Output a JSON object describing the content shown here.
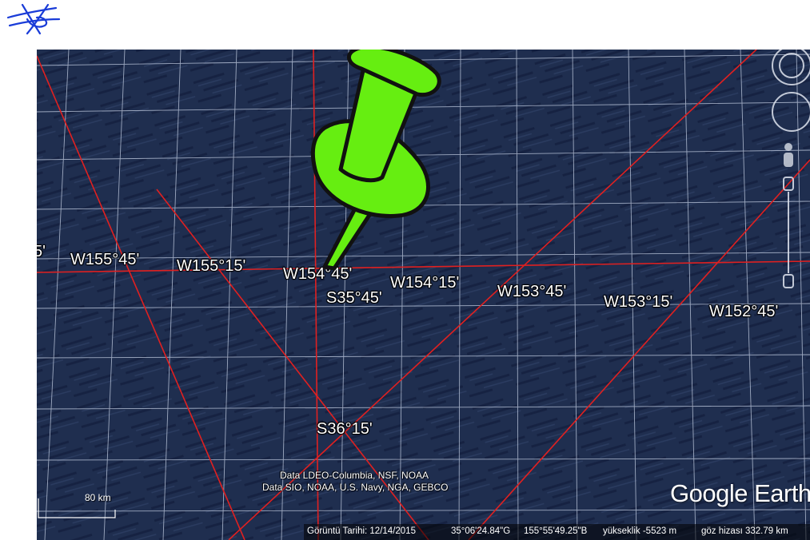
{
  "logo": {
    "icon": "signature-scribble-icon",
    "color": "#1a3cd8"
  },
  "map": {
    "grid_labels": {
      "longitudes": [
        "5'",
        "W155°45'",
        "W155°15'",
        "W154°45'",
        "W154°15'",
        "W153°45'",
        "W153°15'",
        "W152°45'"
      ],
      "latitudes": [
        "S35°45'",
        "S36°15'"
      ]
    },
    "placemark": {
      "icon": "pushpin-icon",
      "color": "#66ee11"
    },
    "ocean_color": "#1f2e4f",
    "line_color": "#e02020",
    "grid_color": "#c8d2e6"
  },
  "attribution": {
    "line1": "Data LDEO-Columbia, NSF, NOAA",
    "line2": "Data SIO, NOAA, U.S. Navy, NGA, GEBCO"
  },
  "scale": {
    "label": "80 km"
  },
  "brand": {
    "text": "Google Earth"
  },
  "status": {
    "date": "Görüntü Tarihi: 12/14/2015",
    "lat": "35°06'24.84\"G",
    "lon": "155°55'49.25\"B",
    "elevation": "yükseklik -5523 m",
    "eye": "göz hizası 332.79 km"
  },
  "nav": {
    "look_icon": "look-joystick-icon",
    "move_icon": "move-joystick-icon",
    "streetview_icon": "pegman-icon",
    "zoom_icon": "zoom-slider-icon"
  }
}
